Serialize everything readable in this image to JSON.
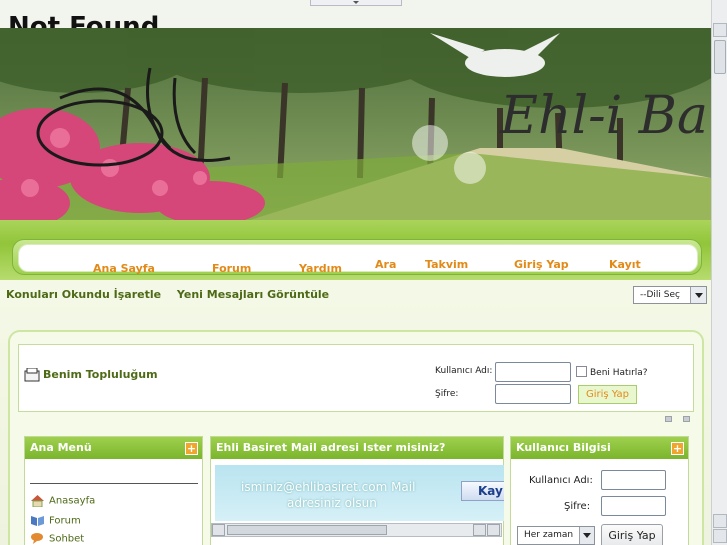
{
  "page": {
    "not_found": "Not Found"
  },
  "banner": {
    "logo_text": "Ehl-i Ba"
  },
  "nav": {
    "items": [
      {
        "label": "Ana Sayfa"
      },
      {
        "label": "Forum"
      },
      {
        "label": "Yardım"
      },
      {
        "label": "Ara"
      },
      {
        "label": "Takvim"
      },
      {
        "label": "Giriş Yap"
      },
      {
        "label": "Kayıt"
      }
    ]
  },
  "sublinks": {
    "mark_read": "Konuları Okundu İşaretle",
    "new_posts": "Yeni Mesajları Görüntüle"
  },
  "language": {
    "selected": "--Dili Seç"
  },
  "login": {
    "community": "Benim Topluluğum",
    "username_label": "Kullanıcı Adı:",
    "password_label": "Şifre:",
    "remember_label": "Beni Hatırla?",
    "submit": "Giriş Yap"
  },
  "panels": {
    "menu": {
      "title": "Ana Menü",
      "items": [
        {
          "label": "Anasayfa",
          "icon": "home-icon"
        },
        {
          "label": "Forum",
          "icon": "book-icon"
        },
        {
          "label": "Sohbet",
          "icon": "chat-icon"
        }
      ]
    },
    "mail": {
      "title": "Ehli Basiret Mail adresi Ister misiniz?",
      "ticker_line1": "isminiz@ehlibasiret.com Mail",
      "ticker_line2": "adresiniz olsun",
      "ticker_button": "Kay"
    },
    "user": {
      "title": "Kullanıcı Bilgisi",
      "username_label": "Kullanıcı Adı:",
      "password_label": "Şifre:",
      "remember_option": "Her zaman",
      "submit": "Giriş Yap"
    }
  },
  "colors": {
    "accent_green": "#7ab52c",
    "nav_orange": "#e28a18",
    "text_green": "#4d6a17"
  }
}
